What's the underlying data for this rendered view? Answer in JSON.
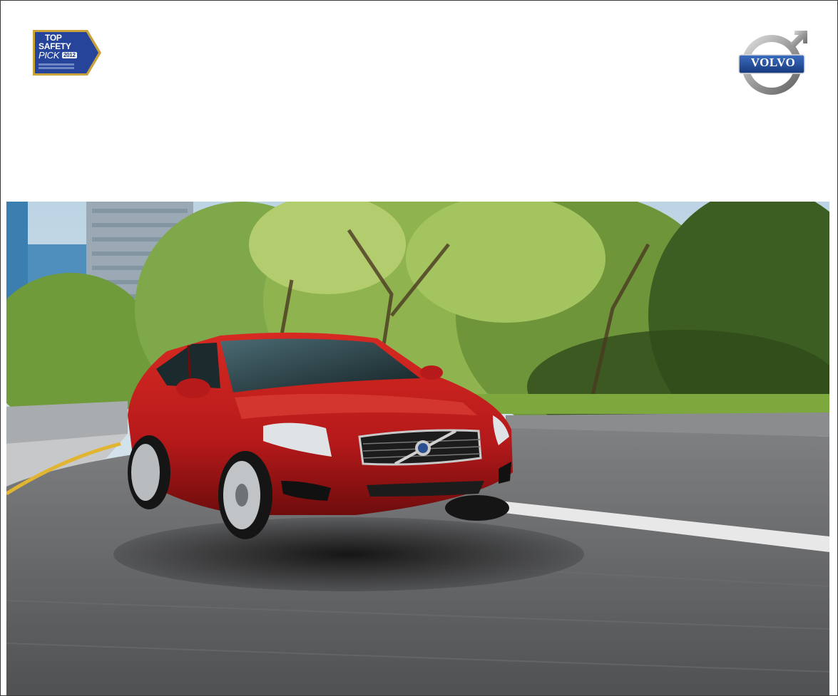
{
  "badge": {
    "line1": "TOP",
    "line2": "SAFETY",
    "line3": "PICK",
    "year": "2012"
  },
  "brand": {
    "logo_text": "VOLVO"
  },
  "colors": {
    "badge_blue": "#25449a",
    "badge_gold": "#c9a23a",
    "car_red": "#b5191a",
    "volvo_blue": "#1f4fa0"
  },
  "hero": {
    "subject": "red sedan on curved road"
  }
}
